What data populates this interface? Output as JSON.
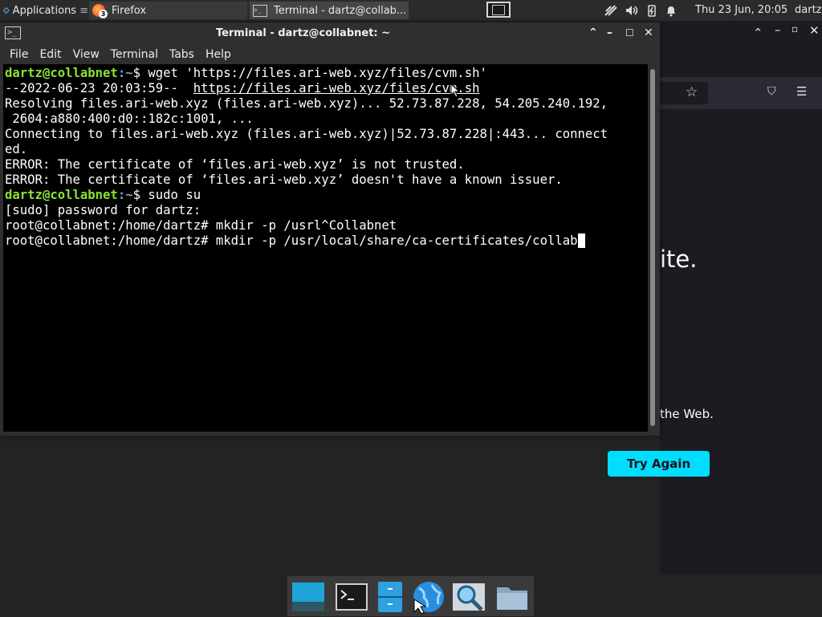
{
  "top_panel": {
    "applications_label": "Applications",
    "tasks": [
      {
        "label": "Firefox",
        "badge": "3"
      },
      {
        "label": "Terminal - dartz@collab..."
      }
    ],
    "clock": "Thu 23 Jun, 20:05",
    "user": "dartz"
  },
  "terminal": {
    "title": "Terminal - dartz@collabnet: ~",
    "menu": [
      "File",
      "Edit",
      "View",
      "Terminal",
      "Tabs",
      "Help"
    ],
    "lines": {
      "l1_user": "dartz@collabnet",
      "l1_path": ":~",
      "l1_cmd": "$ wget 'https://files.ari-web.xyz/files/cvm.sh'",
      "l2_prefix": "--2022-06-23 20:03:59--  ",
      "l2_url": "https://files.ari-web.xyz/files/cvm.sh",
      "l3": "Resolving files.ari-web.xyz (files.ari-web.xyz)... 52.73.87.228, 54.205.240.192,",
      "l4": " 2604:a880:400:d0::182c:1001, ...",
      "l5": "Connecting to files.ari-web.xyz (files.ari-web.xyz)|52.73.87.228|:443... connect",
      "l6": "ed.",
      "l7": "ERROR: The certificate of ‘files.ari-web.xyz’ is not trusted.",
      "l8": "ERROR: The certificate of ‘files.ari-web.xyz’ doesn't have a known issuer.",
      "l9_user": "dartz@collabnet",
      "l9_path": ":~",
      "l9_cmd": "$ sudo su",
      "l10": "[sudo] password for dartz:",
      "l11": "root@collabnet:/home/dartz# mkdir -p /usrl^Collabnet",
      "l12": "root@collabnet:/home/dartz# mkdir -p /usr/local/share/ca-certificates/collab"
    }
  },
  "firefox": {
    "heading_fragment": "ite.",
    "body_fragment": "the Web.",
    "try_again_label": "Try Again"
  },
  "colors": {
    "prompt_user": "#8ae234",
    "prompt_path": "#729fcf",
    "try_again_bg": "#00ddff"
  }
}
